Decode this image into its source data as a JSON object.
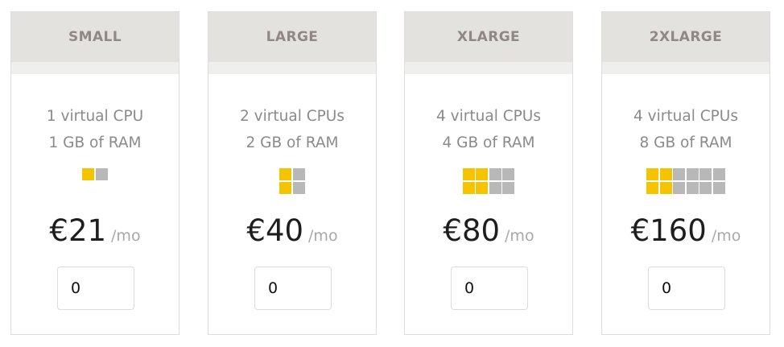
{
  "plans": [
    {
      "name": "SMALL",
      "cpu": "1 virtual CPU",
      "ram": "1 GB of RAM",
      "cpu_count": 1,
      "block_total": 2,
      "block_filled": 1,
      "block_rows": 1,
      "price": "€21",
      "period": "/mo",
      "quantity": "0"
    },
    {
      "name": "LARGE",
      "cpu": "2 virtual CPUs",
      "ram": "2 GB of RAM",
      "cpu_count": 2,
      "block_total": 4,
      "block_filled": 2,
      "block_rows": 2,
      "price": "€40",
      "period": "/mo",
      "quantity": "0"
    },
    {
      "name": "XLARGE",
      "cpu": "4 virtual CPUs",
      "ram": "4 GB of RAM",
      "cpu_count": 4,
      "block_total": 8,
      "block_filled": 4,
      "block_rows": 2,
      "price": "€80",
      "period": "/mo",
      "quantity": "0"
    },
    {
      "name": "2XLARGE",
      "cpu": "4 virtual CPUs",
      "ram": "8 GB of RAM",
      "cpu_count": 4,
      "block_total": 12,
      "block_filled": 4,
      "block_rows": 2,
      "price": "€160",
      "period": "/mo",
      "quantity": "0"
    }
  ],
  "colors": {
    "accent": "#f5c400",
    "inactive_block": "#b8b8b8",
    "header_bg": "#e4e2df",
    "header_text": "#8f8885"
  }
}
